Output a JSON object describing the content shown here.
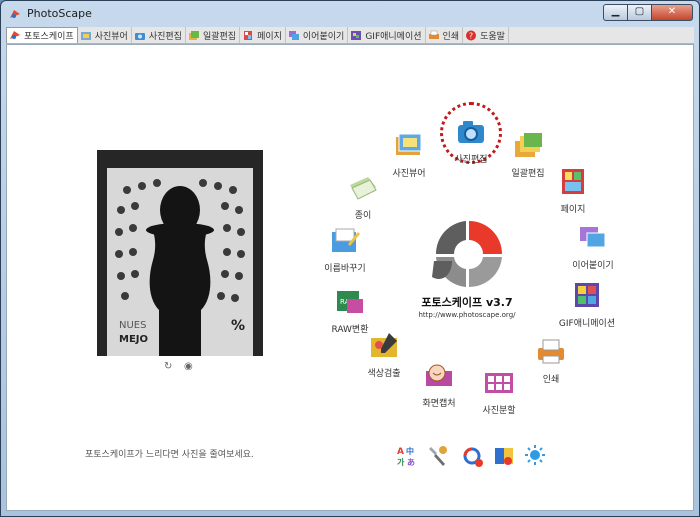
{
  "window": {
    "title": "PhotoScape"
  },
  "tabs": [
    {
      "label": "포토스케이프",
      "icon": "photoscape-logo-icon",
      "active": true
    },
    {
      "label": "사진뷰어",
      "icon": "viewer-icon"
    },
    {
      "label": "사진편집",
      "icon": "editor-icon"
    },
    {
      "label": "일괄편집",
      "icon": "batch-icon"
    },
    {
      "label": "페이지",
      "icon": "page-icon"
    },
    {
      "label": "이어붙이기",
      "icon": "combine-icon"
    },
    {
      "label": "GIF애니메이션",
      "icon": "gif-icon"
    },
    {
      "label": "인쇄",
      "icon": "print-icon"
    },
    {
      "label": "도움말",
      "icon": "help-icon"
    }
  ],
  "menu": {
    "items": [
      {
        "label": "사진편집",
        "name": "editor"
      },
      {
        "label": "일괄편집",
        "name": "batch-editor"
      },
      {
        "label": "페이지",
        "name": "page"
      },
      {
        "label": "이어붙이기",
        "name": "combine"
      },
      {
        "label": "GIF애니메이션",
        "name": "animated-gif"
      },
      {
        "label": "인쇄",
        "name": "print"
      },
      {
        "label": "사진분할",
        "name": "splitter"
      },
      {
        "label": "화면캡처",
        "name": "screen-capture"
      },
      {
        "label": "색상검출",
        "name": "color-picker"
      },
      {
        "label": "RAW변환",
        "name": "raw-converter"
      },
      {
        "label": "이름바꾸기",
        "name": "rename"
      },
      {
        "label": "종이",
        "name": "paper-print"
      },
      {
        "label": "사진뷰어",
        "name": "viewer"
      }
    ]
  },
  "brand": {
    "title": "포토스케이프 v3.7",
    "url": "http://www.photoscape.org/"
  },
  "photo": {
    "sign_text_1": "NUES",
    "sign_text_2": "MEJO",
    "sign_text_3": "%"
  },
  "footer": {
    "tip": "포토스케이프가 느리다면 사진을 줄여보세요."
  },
  "colors": {
    "accent": "#e8392b",
    "highlight": "#c21a1a",
    "logo_gray": "#8c8c8c"
  }
}
